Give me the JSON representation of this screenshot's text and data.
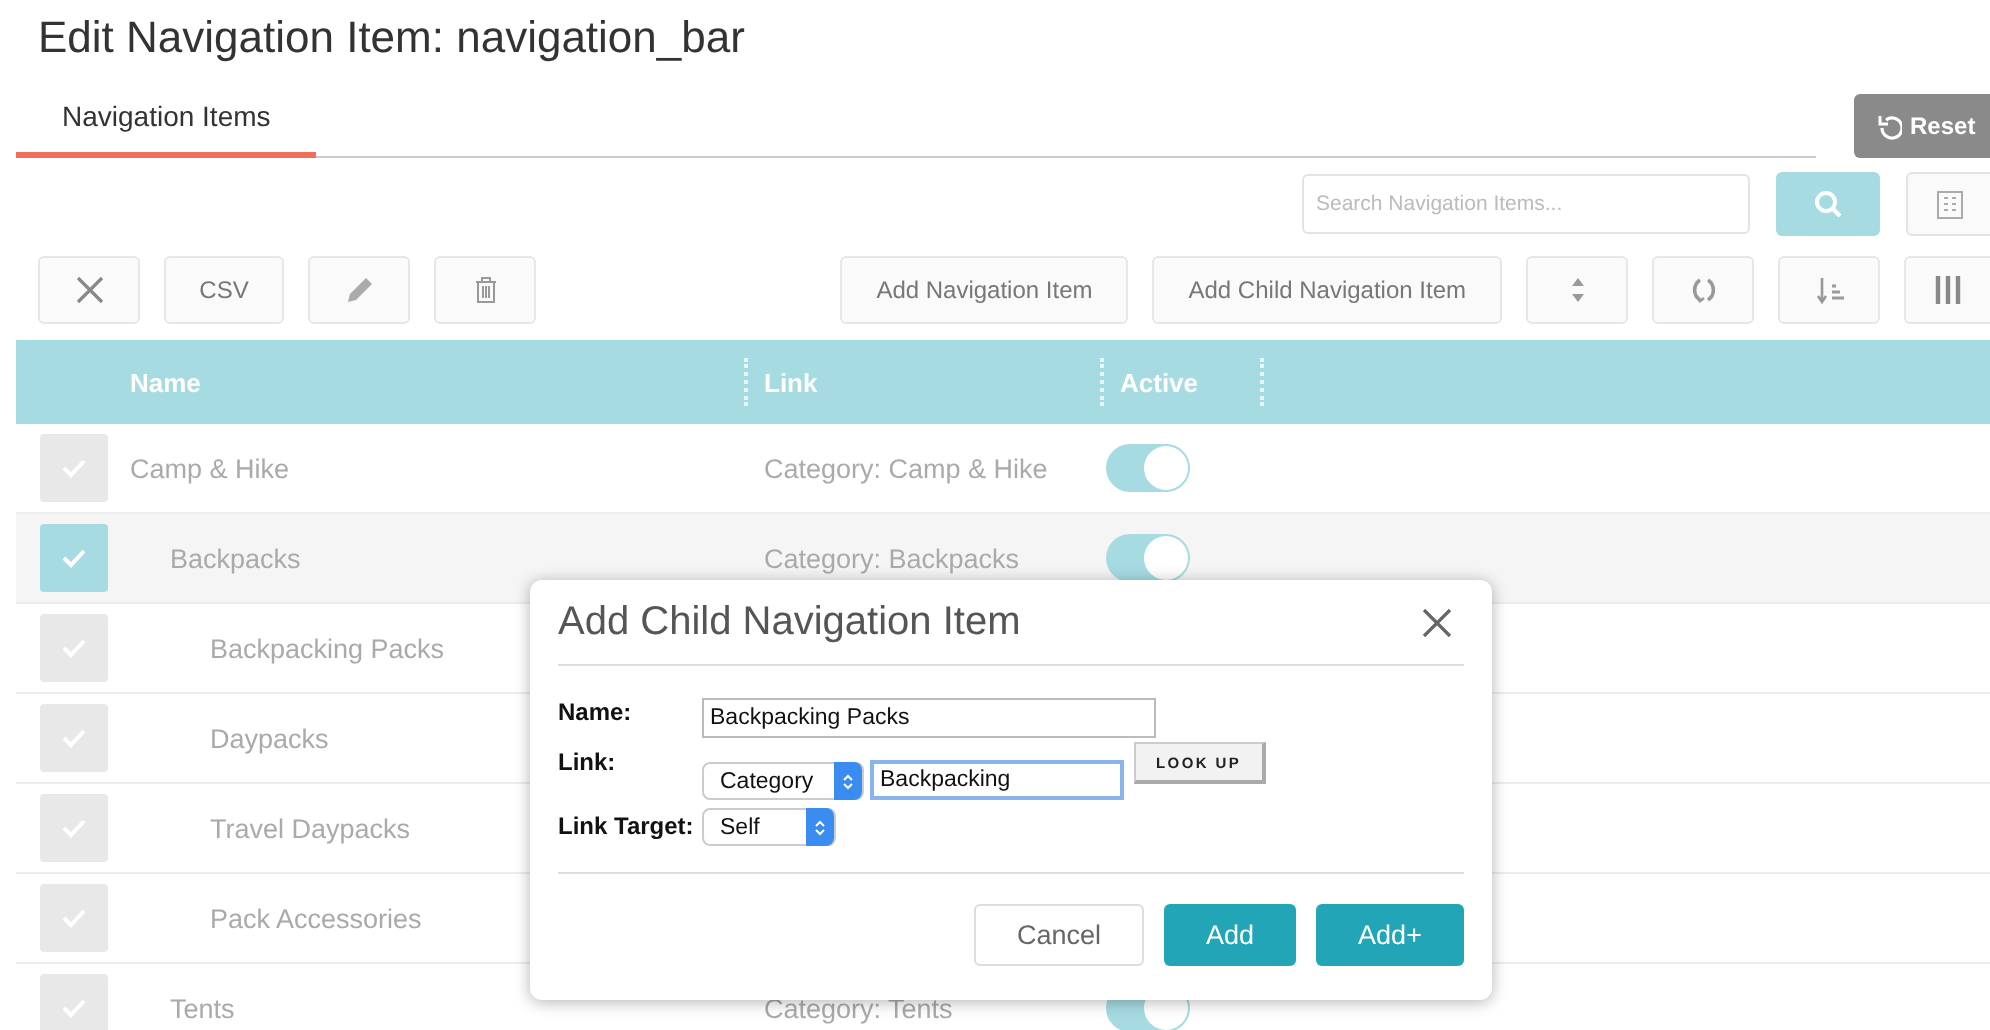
{
  "page": {
    "title": "Edit Navigation Item: navigation_bar",
    "reset_button": "Reset"
  },
  "tabs": [
    {
      "label": "Navigation Items",
      "selected": true
    }
  ],
  "search": {
    "placeholder": "Search Navigation Items..."
  },
  "toolbar": {
    "csv_button": "CSV",
    "add_button": "Add Navigation Item",
    "add_child_button": "Add Child Navigation Item"
  },
  "table": {
    "columns": [
      "Name",
      "Link",
      "Active"
    ],
    "rows": [
      {
        "name": "Camp & Hike",
        "link": "Category: Camp & Hike",
        "active": true,
        "selected": false,
        "children": [
          {
            "name": "Backpacks",
            "link": "Category: Backpacks",
            "active": true,
            "selected": true,
            "children": [
              {
                "name": "Backpacking Packs",
                "selected": false
              },
              {
                "name": "Daypacks",
                "selected": false
              },
              {
                "name": "Travel Daypacks",
                "selected": false
              },
              {
                "name": "Pack Accessories",
                "selected": false
              }
            ]
          },
          {
            "name": "Tents",
            "link": "Category: Tents",
            "active": true,
            "selected": false
          }
        ]
      }
    ]
  },
  "dialog": {
    "title": "Add Child Navigation Item",
    "name_label": "Name:",
    "name_value": "Backpacking Packs",
    "link_label": "Link:",
    "link_type": "Category",
    "link_value": "Backpacking",
    "lookup_button": "LOOK UP",
    "target_label": "Link Target:",
    "target_value": "Self",
    "buttons": [
      {
        "label": "Cancel",
        "kind": "secondary"
      },
      {
        "label": "Add",
        "kind": "primary"
      },
      {
        "label": "Add+",
        "kind": "primary"
      }
    ]
  }
}
